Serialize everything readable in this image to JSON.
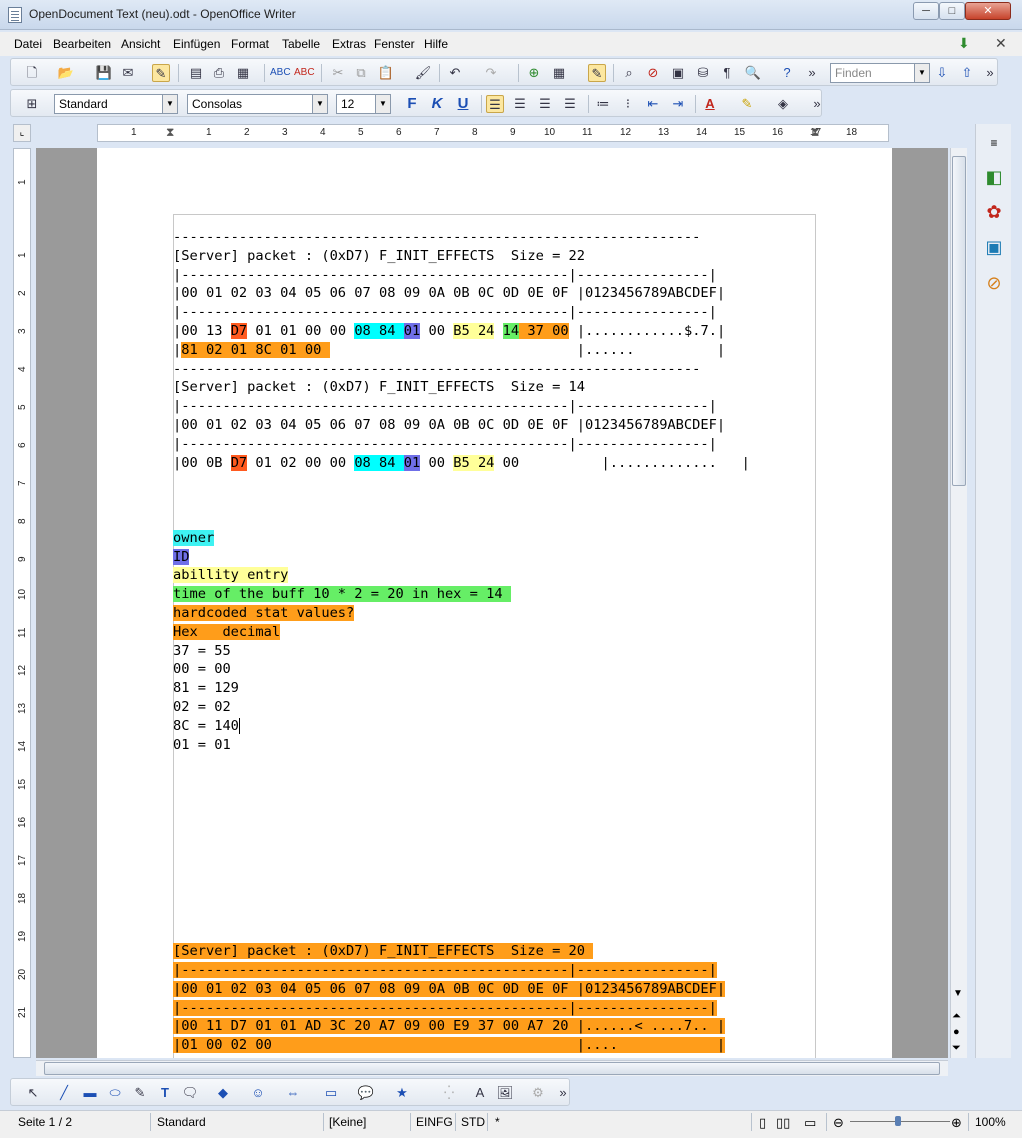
{
  "window": {
    "title": "OpenDocument Text (neu).odt - OpenOffice Writer",
    "minimize": "─",
    "maximize": "□",
    "close": "✕"
  },
  "menu": [
    "Datei",
    "Bearbeiten",
    "Ansicht",
    "Einfügen",
    "Format",
    "Tabelle",
    "Extras",
    "Fenster",
    "Hilfe"
  ],
  "menu_close": "✕",
  "toolbar": {
    "find_placeholder": "Finden",
    "style": "Standard",
    "font": "Consolas",
    "size": "12",
    "bold": "F",
    "italic": "K",
    "underline": "U"
  },
  "ruler": {
    "h": [
      "1",
      "1",
      "2",
      "3",
      "4",
      "5",
      "6",
      "7",
      "8",
      "9",
      "10",
      "11",
      "12",
      "13",
      "14",
      "15",
      "16",
      "17",
      "18"
    ],
    "v": [
      "1",
      "1",
      "2",
      "3",
      "4",
      "5",
      "6",
      "7",
      "8",
      "9",
      "10",
      "11",
      "12",
      "13",
      "14",
      "15",
      "16",
      "17",
      "18",
      "19",
      "20",
      "21"
    ]
  },
  "document": {
    "packet1": {
      "sep_top": "----------------------------------------------------------------",
      "header": "[Server] packet : (0xD7) F_INIT_EFFECTS  Size = 22",
      "sep1": "|-----------------------------------------------|----------------|",
      "cols": "|00 01 02 03 04 05 06 07 08 09 0A 0B 0C 0D 0E 0F |0123456789ABCDEF|",
      "sep2": "|-----------------------------------------------|----------------|",
      "row1_pre": "|00 13 ",
      "row1_d7": "D7",
      "row1_mid": " 01 01 00 00 ",
      "row1_0884": "08 84",
      "row1_sp": " ",
      "row1_01": "01",
      "row1_mid2": " 00 ",
      "row1_b524": "B5 24",
      "row1_sp2": " ",
      "row1_14": "14",
      "row1_sp3": " ",
      "row1_3700": "37 00",
      "row1_ascii": " |............$.7.|",
      "row2_pre": "|",
      "row2_hl": "81 02 01 8C 01 00 ",
      "row2_rest": "                              |......          |",
      "sep_bottom": "----------------------------------------------------------------"
    },
    "packet2": {
      "header": "[Server] packet : (0xD7) F_INIT_EFFECTS  Size = 14",
      "sep1": "|-----------------------------------------------|----------------|",
      "cols": "|00 01 02 03 04 05 06 07 08 09 0A 0B 0C 0D 0E 0F |0123456789ABCDEF|",
      "sep2": "|-----------------------------------------------|----------------|",
      "row_pre": "|00 0B ",
      "row_d7": "D7",
      "row_mid": " 01 02 00 00 ",
      "row_0884": "08 84",
      "row_sp": " ",
      "row_01": "01",
      "row_mid2": " 00 ",
      "row_b524": "B5 24",
      "row_rest": " 00          |.............   |"
    },
    "legend": {
      "owner": "owner",
      "id": "ID",
      "ability": "abillity entry",
      "time": "time of the buff 10 * 2 = 20 in hex = 14 ",
      "hardcoded": "hardcoded stat values?",
      "hex_decimal": "Hex   decimal"
    },
    "conversions": [
      "37 = 55",
      "00 = 00",
      "81 = 129",
      "02 = 02",
      "8C = 140",
      "01 = 01"
    ],
    "packet3": {
      "header": "[Server] packet : (0xD7) F_INIT_EFFECTS  Size = 20 ",
      "sep1": "|-----------------------------------------------|----------------|",
      "cols": "|00 01 02 03 04 05 06 07 08 09 0A 0B 0C 0D 0E 0F |0123456789ABCDEF|",
      "sep2": "|-----------------------------------------------|----------------|",
      "row1": "|00 11 D7 01 01 AD 3C 20 A7 09 00 E9 37 00 A7 20 |......< ....7.. |",
      "row2": "|01 00 02 00                                     |....            |"
    }
  },
  "status": {
    "page": "Seite 1 / 2",
    "style": "Standard",
    "language": "[Keine]",
    "insert": "EINFG",
    "selection": "STD",
    "modified": "*",
    "zoom": "100%"
  }
}
